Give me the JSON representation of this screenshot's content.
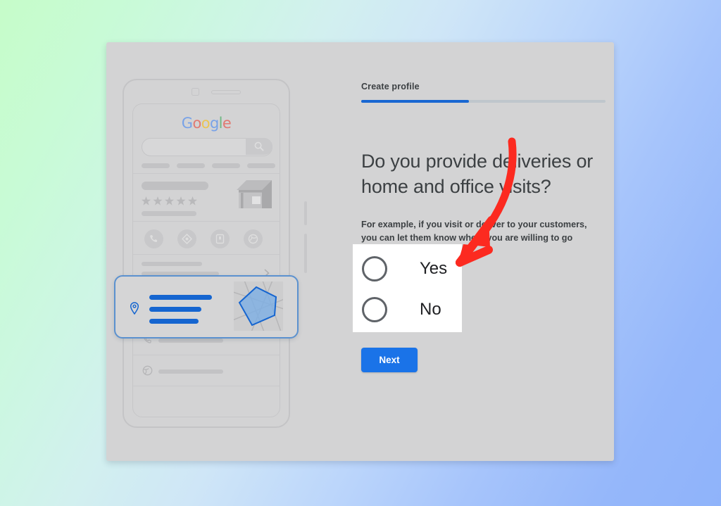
{
  "background": {
    "gradient_from": "#c6fcc9",
    "gradient_to": "#8fb3fa"
  },
  "panel": {
    "background_color": "#d3d3d4"
  },
  "form": {
    "step_label": "Create profile",
    "progress_percent": 44,
    "progress_color": "#1967d2",
    "heading": "Do you provide deliveries or home and office visits?",
    "subtext": "For example, if you visit or deliver to your customers, you can let them know where you are willing to go",
    "options": [
      {
        "label": "Yes",
        "selected": false
      },
      {
        "label": "No",
        "selected": false
      }
    ],
    "next_label": "Next",
    "next_color": "#1a73e8",
    "highlight_box_color": "#ffffff"
  },
  "annotation": {
    "arrow_color": "#fc2a20",
    "points_to": "Yes"
  },
  "phone_mockup": {
    "logo": {
      "text": "Google",
      "letters": [
        {
          "char": "G",
          "color": "#4285f4"
        },
        {
          "char": "o",
          "color": "#ea4335"
        },
        {
          "char": "o",
          "color": "#fbbc05"
        },
        {
          "char": "g",
          "color": "#4285f4"
        },
        {
          "char": "l",
          "color": "#34a853"
        },
        {
          "char": "e",
          "color": "#ea4335"
        }
      ]
    },
    "search_icon": "search-icon",
    "rating_stars": 5,
    "action_icons": [
      "call-icon",
      "directions-icon",
      "save-icon",
      "share-icon"
    ],
    "list_row_icons": [
      "clock-icon",
      "phone-icon",
      "globe-icon"
    ],
    "service_area_card": {
      "highlighted": true,
      "border_color": "#5b91cf",
      "bar_color": "#1565d0",
      "pin_icon": "location-pin-icon",
      "map_thumbnail": "service-area-map",
      "polygon_color": "#7baee6"
    }
  }
}
